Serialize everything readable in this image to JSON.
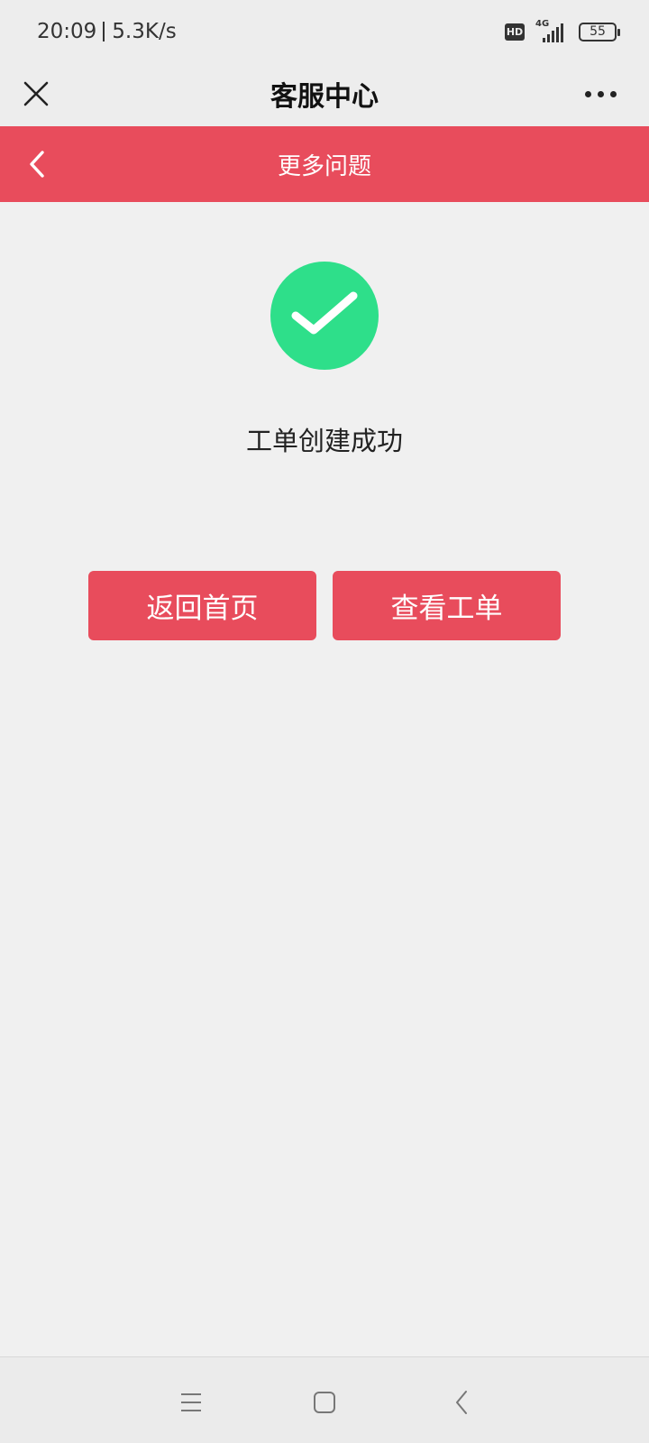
{
  "status_bar": {
    "time": "20:09",
    "net_speed": "5.3K/s",
    "hd_label": "HD",
    "network_type": "4G",
    "battery_level": "55",
    "icons": [
      "hd-icon",
      "signal-icon",
      "battery-icon"
    ]
  },
  "title_bar": {
    "title": "客服中心",
    "close_icon": "close-icon",
    "more_icon": "more-icon"
  },
  "sub_header": {
    "title": "更多问题",
    "back_icon": "chevron-left-icon"
  },
  "result": {
    "icon": "checkmark-icon",
    "message": "工单创建成功"
  },
  "actions": {
    "home_label": "返回首页",
    "view_ticket_label": "查看工单"
  },
  "nav_bar": {
    "icons": [
      "menu-icon",
      "home-icon",
      "back-icon"
    ]
  },
  "colors": {
    "accent": "#e84c5c",
    "success": "#2edf8a",
    "background": "#f0f0f0"
  }
}
